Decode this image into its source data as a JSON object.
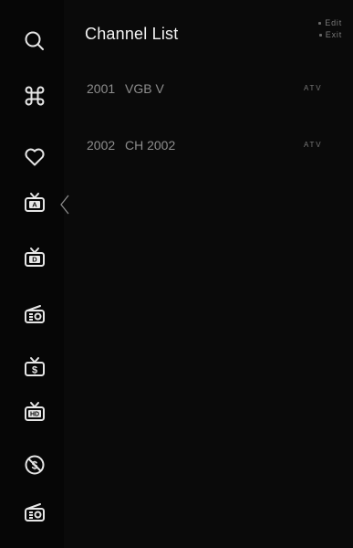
{
  "header": {
    "title": "Channel List"
  },
  "hints": [
    {
      "label": "Edit"
    },
    {
      "label": "Exit"
    }
  ],
  "sidebar": {
    "items": [
      {
        "icon": "search-icon"
      },
      {
        "icon": "command-icon"
      },
      {
        "icon": "heart-icon"
      },
      {
        "icon": "tv-analog-icon",
        "badge": "A",
        "selected": true
      },
      {
        "icon": "tv-digital-icon",
        "badge": "D"
      },
      {
        "icon": "radio-icon"
      },
      {
        "icon": "tv-pay-icon",
        "badge": "$"
      },
      {
        "icon": "tv-hd-icon",
        "badge": "HD"
      },
      {
        "icon": "free-icon"
      },
      {
        "icon": "radio-icon"
      }
    ]
  },
  "channels": [
    {
      "number": "2001",
      "name": "VGB V",
      "type": "ATV"
    },
    {
      "number": "2002",
      "name": "CH 2002",
      "type": "ATV"
    }
  ]
}
